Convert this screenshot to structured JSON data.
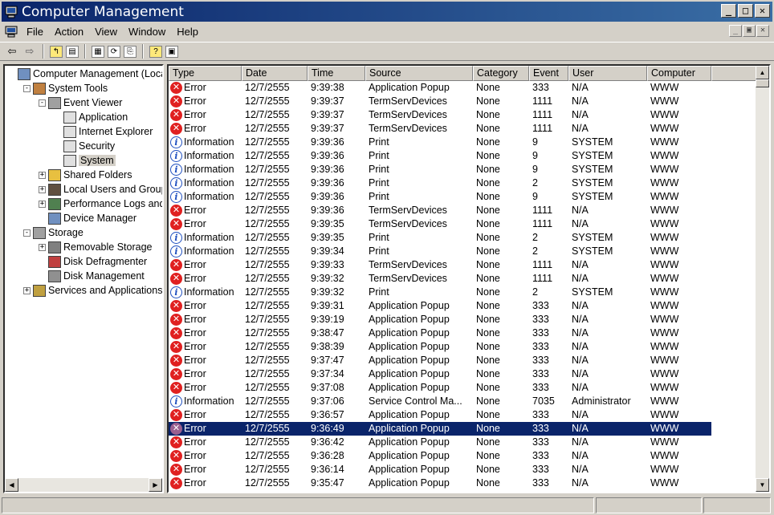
{
  "window": {
    "title": "Computer Management"
  },
  "menus": [
    "File",
    "Action",
    "View",
    "Window",
    "Help"
  ],
  "tree": [
    {
      "label": "Computer Management (Local",
      "depth": 0,
      "exp": "",
      "icon": "computer-icon"
    },
    {
      "label": "System Tools",
      "depth": 1,
      "exp": "-",
      "icon": "tools-icon"
    },
    {
      "label": "Event Viewer",
      "depth": 2,
      "exp": "-",
      "icon": "event-viewer-icon"
    },
    {
      "label": "Application",
      "depth": 3,
      "exp": "",
      "icon": "log-icon"
    },
    {
      "label": "Internet Explorer",
      "depth": 3,
      "exp": "",
      "icon": "log-icon"
    },
    {
      "label": "Security",
      "depth": 3,
      "exp": "",
      "icon": "log-icon"
    },
    {
      "label": "System",
      "depth": 3,
      "exp": "",
      "icon": "log-icon",
      "selected": true
    },
    {
      "label": "Shared Folders",
      "depth": 2,
      "exp": "+",
      "icon": "folder-icon"
    },
    {
      "label": "Local Users and Groups",
      "depth": 2,
      "exp": "+",
      "icon": "users-icon"
    },
    {
      "label": "Performance Logs and A",
      "depth": 2,
      "exp": "+",
      "icon": "performance-icon"
    },
    {
      "label": "Device Manager",
      "depth": 2,
      "exp": "",
      "icon": "device-manager-icon"
    },
    {
      "label": "Storage",
      "depth": 1,
      "exp": "-",
      "icon": "storage-icon"
    },
    {
      "label": "Removable Storage",
      "depth": 2,
      "exp": "+",
      "icon": "removable-storage-icon"
    },
    {
      "label": "Disk Defragmenter",
      "depth": 2,
      "exp": "",
      "icon": "defrag-icon"
    },
    {
      "label": "Disk Management",
      "depth": 2,
      "exp": "",
      "icon": "disk-icon"
    },
    {
      "label": "Services and Applications",
      "depth": 1,
      "exp": "+",
      "icon": "services-icon"
    }
  ],
  "columns": [
    "Type",
    "Date",
    "Time",
    "Source",
    "Category",
    "Event",
    "User",
    "Computer"
  ],
  "rows": [
    {
      "type": "Error",
      "date": "12/7/2555",
      "time": "9:39:38",
      "source": "Application Popup",
      "category": "None",
      "event": "333",
      "user": "N/A",
      "computer": "WWW"
    },
    {
      "type": "Error",
      "date": "12/7/2555",
      "time": "9:39:37",
      "source": "TermServDevices",
      "category": "None",
      "event": "1111",
      "user": "N/A",
      "computer": "WWW"
    },
    {
      "type": "Error",
      "date": "12/7/2555",
      "time": "9:39:37",
      "source": "TermServDevices",
      "category": "None",
      "event": "1111",
      "user": "N/A",
      "computer": "WWW"
    },
    {
      "type": "Error",
      "date": "12/7/2555",
      "time": "9:39:37",
      "source": "TermServDevices",
      "category": "None",
      "event": "1111",
      "user": "N/A",
      "computer": "WWW"
    },
    {
      "type": "Information",
      "date": "12/7/2555",
      "time": "9:39:36",
      "source": "Print",
      "category": "None",
      "event": "9",
      "user": "SYSTEM",
      "computer": "WWW"
    },
    {
      "type": "Information",
      "date": "12/7/2555",
      "time": "9:39:36",
      "source": "Print",
      "category": "None",
      "event": "9",
      "user": "SYSTEM",
      "computer": "WWW"
    },
    {
      "type": "Information",
      "date": "12/7/2555",
      "time": "9:39:36",
      "source": "Print",
      "category": "None",
      "event": "9",
      "user": "SYSTEM",
      "computer": "WWW"
    },
    {
      "type": "Information",
      "date": "12/7/2555",
      "time": "9:39:36",
      "source": "Print",
      "category": "None",
      "event": "2",
      "user": "SYSTEM",
      "computer": "WWW"
    },
    {
      "type": "Information",
      "date": "12/7/2555",
      "time": "9:39:36",
      "source": "Print",
      "category": "None",
      "event": "9",
      "user": "SYSTEM",
      "computer": "WWW"
    },
    {
      "type": "Error",
      "date": "12/7/2555",
      "time": "9:39:36",
      "source": "TermServDevices",
      "category": "None",
      "event": "1111",
      "user": "N/A",
      "computer": "WWW"
    },
    {
      "type": "Error",
      "date": "12/7/2555",
      "time": "9:39:35",
      "source": "TermServDevices",
      "category": "None",
      "event": "1111",
      "user": "N/A",
      "computer": "WWW"
    },
    {
      "type": "Information",
      "date": "12/7/2555",
      "time": "9:39:35",
      "source": "Print",
      "category": "None",
      "event": "2",
      "user": "SYSTEM",
      "computer": "WWW"
    },
    {
      "type": "Information",
      "date": "12/7/2555",
      "time": "9:39:34",
      "source": "Print",
      "category": "None",
      "event": "2",
      "user": "SYSTEM",
      "computer": "WWW"
    },
    {
      "type": "Error",
      "date": "12/7/2555",
      "time": "9:39:33",
      "source": "TermServDevices",
      "category": "None",
      "event": "1111",
      "user": "N/A",
      "computer": "WWW"
    },
    {
      "type": "Error",
      "date": "12/7/2555",
      "time": "9:39:32",
      "source": "TermServDevices",
      "category": "None",
      "event": "1111",
      "user": "N/A",
      "computer": "WWW"
    },
    {
      "type": "Information",
      "date": "12/7/2555",
      "time": "9:39:32",
      "source": "Print",
      "category": "None",
      "event": "2",
      "user": "SYSTEM",
      "computer": "WWW"
    },
    {
      "type": "Error",
      "date": "12/7/2555",
      "time": "9:39:31",
      "source": "Application Popup",
      "category": "None",
      "event": "333",
      "user": "N/A",
      "computer": "WWW"
    },
    {
      "type": "Error",
      "date": "12/7/2555",
      "time": "9:39:19",
      "source": "Application Popup",
      "category": "None",
      "event": "333",
      "user": "N/A",
      "computer": "WWW"
    },
    {
      "type": "Error",
      "date": "12/7/2555",
      "time": "9:38:47",
      "source": "Application Popup",
      "category": "None",
      "event": "333",
      "user": "N/A",
      "computer": "WWW"
    },
    {
      "type": "Error",
      "date": "12/7/2555",
      "time": "9:38:39",
      "source": "Application Popup",
      "category": "None",
      "event": "333",
      "user": "N/A",
      "computer": "WWW"
    },
    {
      "type": "Error",
      "date": "12/7/2555",
      "time": "9:37:47",
      "source": "Application Popup",
      "category": "None",
      "event": "333",
      "user": "N/A",
      "computer": "WWW"
    },
    {
      "type": "Error",
      "date": "12/7/2555",
      "time": "9:37:34",
      "source": "Application Popup",
      "category": "None",
      "event": "333",
      "user": "N/A",
      "computer": "WWW"
    },
    {
      "type": "Error",
      "date": "12/7/2555",
      "time": "9:37:08",
      "source": "Application Popup",
      "category": "None",
      "event": "333",
      "user": "N/A",
      "computer": "WWW"
    },
    {
      "type": "Information",
      "date": "12/7/2555",
      "time": "9:37:06",
      "source": "Service Control Ma...",
      "category": "None",
      "event": "7035",
      "user": "Administrator",
      "computer": "WWW"
    },
    {
      "type": "Error",
      "date": "12/7/2555",
      "time": "9:36:57",
      "source": "Application Popup",
      "category": "None",
      "event": "333",
      "user": "N/A",
      "computer": "WWW"
    },
    {
      "type": "Error",
      "date": "12/7/2555",
      "time": "9:36:49",
      "source": "Application Popup",
      "category": "None",
      "event": "333",
      "user": "N/A",
      "computer": "WWW",
      "selected": true
    },
    {
      "type": "Error",
      "date": "12/7/2555",
      "time": "9:36:42",
      "source": "Application Popup",
      "category": "None",
      "event": "333",
      "user": "N/A",
      "computer": "WWW"
    },
    {
      "type": "Error",
      "date": "12/7/2555",
      "time": "9:36:28",
      "source": "Application Popup",
      "category": "None",
      "event": "333",
      "user": "N/A",
      "computer": "WWW"
    },
    {
      "type": "Error",
      "date": "12/7/2555",
      "time": "9:36:14",
      "source": "Application Popup",
      "category": "None",
      "event": "333",
      "user": "N/A",
      "computer": "WWW"
    },
    {
      "type": "Error",
      "date": "12/7/2555",
      "time": "9:35:47",
      "source": "Application Popup",
      "category": "None",
      "event": "333",
      "user": "N/A",
      "computer": "WWW"
    }
  ]
}
